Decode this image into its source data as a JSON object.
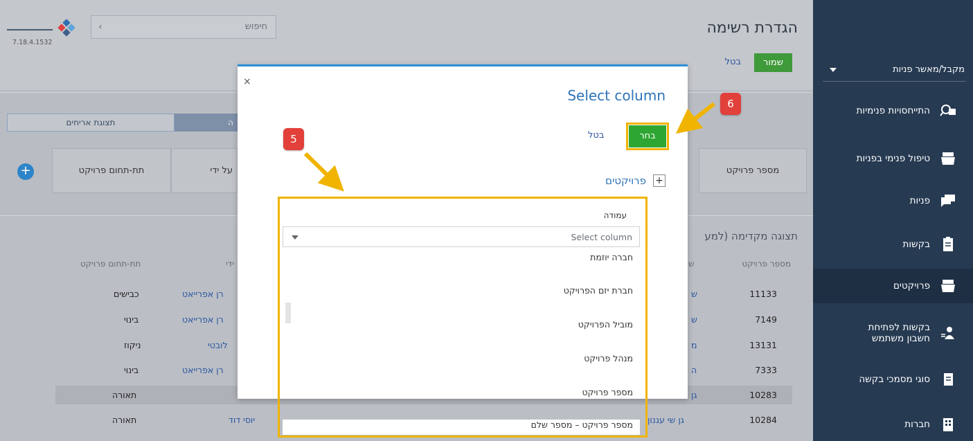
{
  "header": {
    "title": "הגדרת רשימה",
    "save_label": "שמור",
    "cancel_label": "בטל",
    "search_placeholder": "חיפוש",
    "version": "7.18.4.1532"
  },
  "sidebar": {
    "dropdown_label": "מקבל/מאשר פניות",
    "items": [
      {
        "label": "התייחסויות פנימיות",
        "icon": "search-chat-icon"
      },
      {
        "label": "טיפול פנימי בפניות",
        "icon": "inbox-icon"
      },
      {
        "label": "פניות",
        "icon": "chat-icon"
      },
      {
        "label": "בקשות",
        "icon": "clipboard-icon"
      },
      {
        "label": "פרויקטים",
        "icon": "inbox-icon"
      },
      {
        "label": "בקשות לפתיחת",
        "label2": "חשבון משתמש",
        "icon": "user-add-icon"
      },
      {
        "label": "סוגי מסמכי בקשה",
        "icon": "document-icon"
      },
      {
        "label": "חברות",
        "icon": "building-icon"
      }
    ]
  },
  "panel": {
    "tab_hosts": "תצוגת אריחים",
    "tab_active": "ה",
    "columns": [
      "מספר פרויקט",
      "על ידי",
      "תת-תחום פרויקט"
    ]
  },
  "preview": {
    "title": "תצוגה מקדימה (למע",
    "headers": [
      "מספר פרויקט",
      "ש",
      "ידי",
      "תת-תחום פרויקט"
    ],
    "rows": [
      {
        "num": "11133",
        "c2": "ש",
        "c3": "רן אפרייאט",
        "c4": "כבישים"
      },
      {
        "num": "7149",
        "c2": "ש",
        "c3": "רן אפרייאט",
        "c4": "בינוי"
      },
      {
        "num": "13131",
        "c2": "מ",
        "c3": "לובטי",
        "c4": "ניקוז"
      },
      {
        "num": "7333",
        "c2": "ה",
        "c3": "רן אפרייאט",
        "c4": "בינוי"
      },
      {
        "num": "10283",
        "c2": "גן",
        "c3": "",
        "c4": "תאורה"
      },
      {
        "num": "10284",
        "c2": "גן שי עגנון",
        "c3": "יוסי דוד",
        "c4": "תאורה"
      }
    ]
  },
  "modal": {
    "title": "Select column",
    "choose_label": "בחר",
    "cancel_label": "בטל",
    "close_glyph": "×",
    "group_label": "פרויקטים",
    "field_label": "עמודה",
    "select_placeholder": "Select column",
    "options": [
      "חברה יוזמת",
      "חברת יזם הפרויקט",
      "מוביל הפרויקט",
      "מנהל פרויקט",
      "מספר פרויקט",
      "מספר פרויקט – מספר שלם"
    ]
  },
  "annotations": {
    "badge_5": "5",
    "badge_6": "6"
  }
}
